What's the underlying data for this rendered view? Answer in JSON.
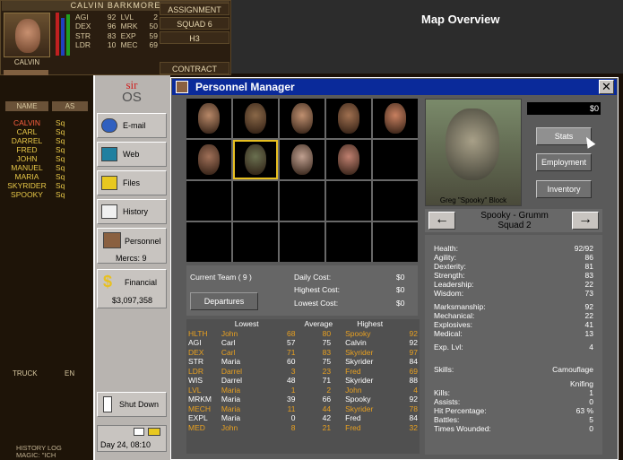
{
  "merc_panel": {
    "full_name": "CALVIN BARKMORE",
    "short_name": "CALVIN",
    "stats": [
      {
        "label": "AGI",
        "value": "92",
        "label2": "LVL",
        "value2": "2"
      },
      {
        "label": "DEX",
        "value": "96",
        "label2": "MRK",
        "value2": "50"
      },
      {
        "label": "STR",
        "value": "83",
        "label2": "EXP",
        "value2": "59"
      },
      {
        "label": "LDR",
        "value": "10",
        "label2": "MEC",
        "value2": "69"
      }
    ],
    "assignment_label": "ASSIGNMENT",
    "assignment": "SQUAD 6",
    "sector": "H3",
    "contract_label": "CONTRACT",
    "colors": {
      "health": "#c02020",
      "energy": "#2040c0",
      "morale": "#20a020"
    }
  },
  "map_title": "Map Overview",
  "team_list": {
    "name_header": "NAME",
    "assign_header": "AS",
    "names": [
      "CALVIN",
      "CARL",
      "DARREL",
      "FRED",
      "JOHN",
      "MANUEL",
      "MARIA",
      "SKYRIDER",
      "SPOOKY"
    ],
    "assign_prefix": "Sq",
    "truck": "TRUCK",
    "en": "EN"
  },
  "history_log": {
    "title": "HISTORY LOG",
    "line": "MAGIC: \"ICH"
  },
  "laptop": {
    "logo_top": "sir",
    "logo_bottom": "OS",
    "email": "E-mail",
    "web": "Web",
    "files": "Files",
    "history": "History",
    "personnel": "Personnel",
    "mercs": "Mercs: 9",
    "financial": "Financial",
    "balance": "$3,097,358",
    "shutdown": "Shut Down",
    "day": "Day 24, 08:10"
  },
  "personnel": {
    "title": "Personnel Manager",
    "close": "✕",
    "portrait_colors": [
      "#b88868",
      "#8a6848",
      "#c09070",
      "#a07050",
      "#c88060",
      "#a07058",
      "#6a7050",
      "#c0a090",
      "#c08070"
    ],
    "selected_index": 6,
    "selected_name": "Greg \"Spooky\" Block",
    "money": "$0",
    "buttons": {
      "stats": "Stats",
      "employment": "Employment",
      "inventory": "Inventory"
    },
    "merc_label": "Spooky - Grumm",
    "merc_squad": "Squad 2",
    "stats": [
      [
        "Health:",
        "92/92"
      ],
      [
        "Agility:",
        "86"
      ],
      [
        "Dexterity:",
        "81"
      ],
      [
        "Strength:",
        "83"
      ],
      [
        "Leadership:",
        "22"
      ],
      [
        "Wisdom:",
        "73"
      ],
      [
        "",
        ""
      ],
      [
        "Marksmanship:",
        "92"
      ],
      [
        "Mechanical:",
        "22"
      ],
      [
        "Explosives:",
        "41"
      ],
      [
        "Medical:",
        "13"
      ],
      [
        "",
        ""
      ],
      [
        "Exp. Lvl:",
        "4"
      ]
    ],
    "skills_label": "Skills:",
    "skills": [
      "Camouflage",
      "Knifing"
    ],
    "records": [
      [
        "Kills:",
        "1"
      ],
      [
        "Assists:",
        "0"
      ],
      [
        "Hit Percentage:",
        "63 %"
      ],
      [
        "Battles:",
        "5"
      ],
      [
        "Times Wounded:",
        "0"
      ]
    ],
    "team": {
      "current": "Current Team ( 9 )",
      "daily_label": "Daily Cost:",
      "daily": "$0",
      "highest_label": "Highest Cost:",
      "highest": "$0",
      "lowest_label": "Lowest Cost:",
      "lowest": "$0",
      "departures": "Departures"
    },
    "table": {
      "headers": [
        "",
        "Lowest",
        "",
        "Average",
        "Highest",
        ""
      ],
      "rows": [
        {
          "stat": "HLTH",
          "low_name": "John",
          "low": "68",
          "avg": "80",
          "high_name": "Spooky",
          "high": "92",
          "hl": true
        },
        {
          "stat": "AGI",
          "low_name": "Carl",
          "low": "57",
          "avg": "75",
          "high_name": "Calvin",
          "high": "92",
          "hl": false
        },
        {
          "stat": "DEX",
          "low_name": "Carl",
          "low": "71",
          "avg": "83",
          "high_name": "Skyrider",
          "high": "97",
          "hl": true
        },
        {
          "stat": "STR",
          "low_name": "Maria",
          "low": "60",
          "avg": "75",
          "high_name": "Skyrider",
          "high": "84",
          "hl": false
        },
        {
          "stat": "LDR",
          "low_name": "Darrel",
          "low": "3",
          "avg": "23",
          "high_name": "Fred",
          "high": "69",
          "hl": true
        },
        {
          "stat": "WIS",
          "low_name": "Darrel",
          "low": "48",
          "avg": "71",
          "high_name": "Skyrider",
          "high": "88",
          "hl": false
        },
        {
          "stat": "LVL",
          "low_name": "Maria",
          "low": "1",
          "avg": "2",
          "high_name": "John",
          "high": "4",
          "hl": true
        },
        {
          "stat": "MRKM",
          "low_name": "Maria",
          "low": "39",
          "avg": "66",
          "high_name": "Spooky",
          "high": "92",
          "hl": false
        },
        {
          "stat": "MECH",
          "low_name": "Maria",
          "low": "11",
          "avg": "44",
          "high_name": "Skyrider",
          "high": "78",
          "hl": true
        },
        {
          "stat": "EXPL",
          "low_name": "Maria",
          "low": "0",
          "avg": "42",
          "high_name": "Fred",
          "high": "84",
          "hl": false
        },
        {
          "stat": "MED",
          "low_name": "John",
          "low": "8",
          "avg": "21",
          "high_name": "Fred",
          "high": "32",
          "hl": true
        }
      ]
    }
  }
}
